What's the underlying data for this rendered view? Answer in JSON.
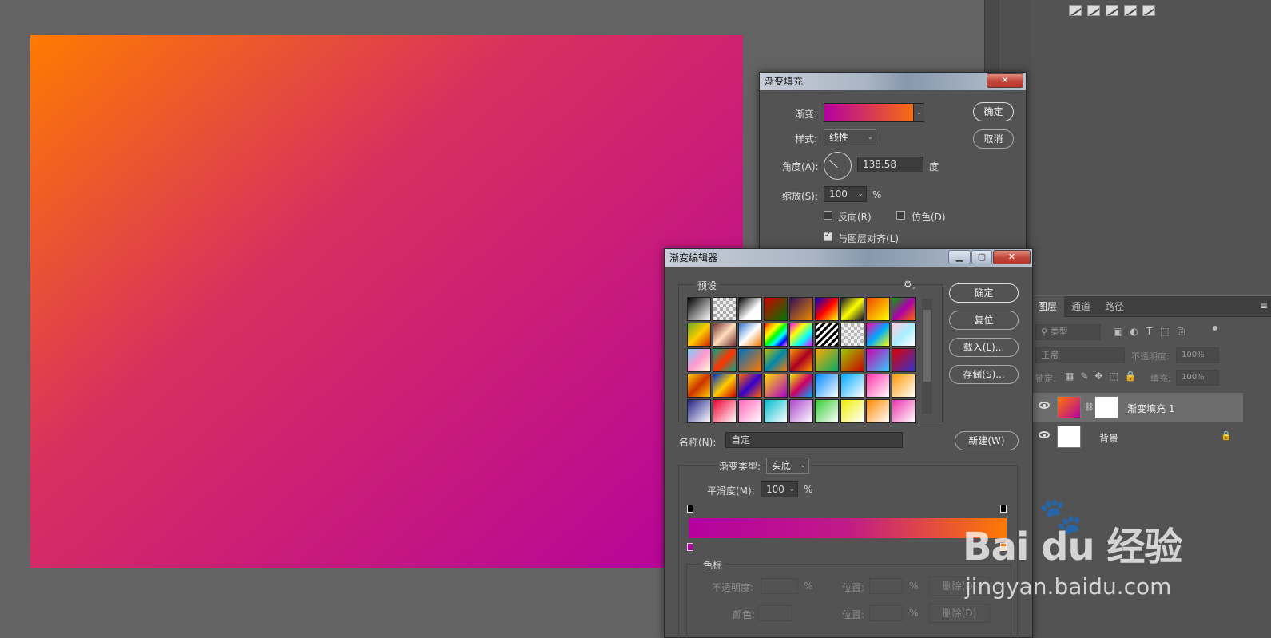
{
  "layers_panel": {
    "tabs": [
      "图层",
      "通道",
      "路径"
    ],
    "filter_placeholder": "类型",
    "blend_mode": "正常",
    "opacity_label": "不透明度:",
    "opacity_value": "100%",
    "lock_label": "锁定:",
    "fill_label": "填充:",
    "fill_value": "100%",
    "layers": [
      {
        "name": "渐变填充 1",
        "selected": true
      },
      {
        "name": "背景",
        "selected": false
      }
    ]
  },
  "gradient_fill": {
    "title": "渐变填充",
    "close": "✕",
    "gradient_label": "渐变:",
    "style_label": "样式:",
    "style_value": "线性",
    "angle_label": "角度(A):",
    "angle_value": "138.58",
    "angle_unit": "度",
    "scale_label": "缩放(S):",
    "scale_value": "100",
    "percent": "%",
    "reverse": "反向(R)",
    "dither": "仿色(D)",
    "align": "与图层对齐(L)",
    "ok": "确定",
    "cancel": "取消"
  },
  "gradient_editor": {
    "title": "渐变编辑器",
    "presets_label": "预设",
    "ok": "确定",
    "reset": "复位",
    "load": "载入(L)...",
    "save": "存储(S)...",
    "name_label": "名称(N):",
    "name_value": "自定",
    "new_button": "新建(W)",
    "type_label": "渐变类型:",
    "type_value": "实底",
    "smooth_label": "平滑度(M):",
    "smooth_value": "100",
    "percent": "%",
    "stops_label": "色标",
    "opacity_label": "不透明度:",
    "location_label": "位置:",
    "color_label": "颜色:",
    "delete_label": "删除(D)"
  },
  "colors": {
    "start": "#b5009f",
    "end": "#ff7a00"
  },
  "watermark": {
    "brand": "Bai du 经验",
    "url": "jingyan.baidu.com"
  }
}
